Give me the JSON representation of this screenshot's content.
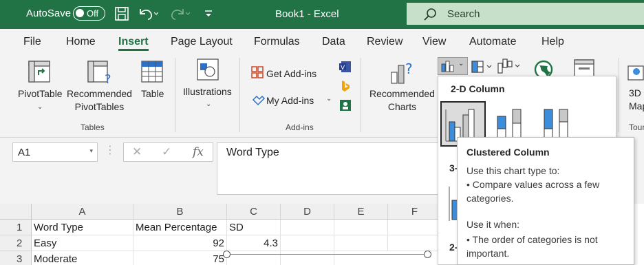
{
  "titlebar": {
    "autosave_label": "AutoSave",
    "autosave_state": "Off",
    "doc_title": "Book1  -  Excel",
    "search_placeholder": "Search"
  },
  "tabs": [
    "File",
    "Home",
    "Insert",
    "Page Layout",
    "Formulas",
    "Data",
    "Review",
    "View",
    "Automate",
    "Help"
  ],
  "active_tab": "Insert",
  "ribbon": {
    "tables": {
      "pivot_table_label": "PivotTable",
      "recommended_pivot_label_1": "Recommended",
      "recommended_pivot_label_2": "PivotTables",
      "table_label": "Table",
      "group_label": "Tables"
    },
    "illustrations": {
      "label": "Illustrations"
    },
    "addins": {
      "get_addins": "Get Add-ins",
      "my_addins": "My Add-ins",
      "group_label": "Add-ins"
    },
    "charts": {
      "recommended_label_1": "Recommended",
      "recommended_label_2": "Charts"
    },
    "overflow": {
      "label_1": "3D",
      "label_2": "Map",
      "group_label": "Tour"
    }
  },
  "formula_bar": {
    "name_box": "A1",
    "fx": "fx",
    "content": "Word Type"
  },
  "grid": {
    "columns": [
      "A",
      "B",
      "C",
      "D",
      "E",
      "F"
    ],
    "rows": [
      {
        "num": "1",
        "A": "Word Type",
        "B": "Mean Percentage",
        "C": "SD"
      },
      {
        "num": "2",
        "A": "Easy",
        "B": "92",
        "C": "4.3"
      },
      {
        "num": "3",
        "A": "Moderate",
        "B": "75",
        "C": ""
      }
    ]
  },
  "chart_dropdown": {
    "header": "2-D Column",
    "cut_labels": [
      "3-",
      "2-"
    ]
  },
  "tooltip": {
    "title": "Clustered Column",
    "line1": "Use this chart type to:",
    "line2": "• Compare values across a few",
    "line3": "categories.",
    "line4": "Use it when:",
    "line5": "• The order of categories is not",
    "line6": "important."
  },
  "colors": {
    "accent": "#217346",
    "search_bg": "#c7e0c9",
    "chart_blue": "#3d8ddd"
  }
}
